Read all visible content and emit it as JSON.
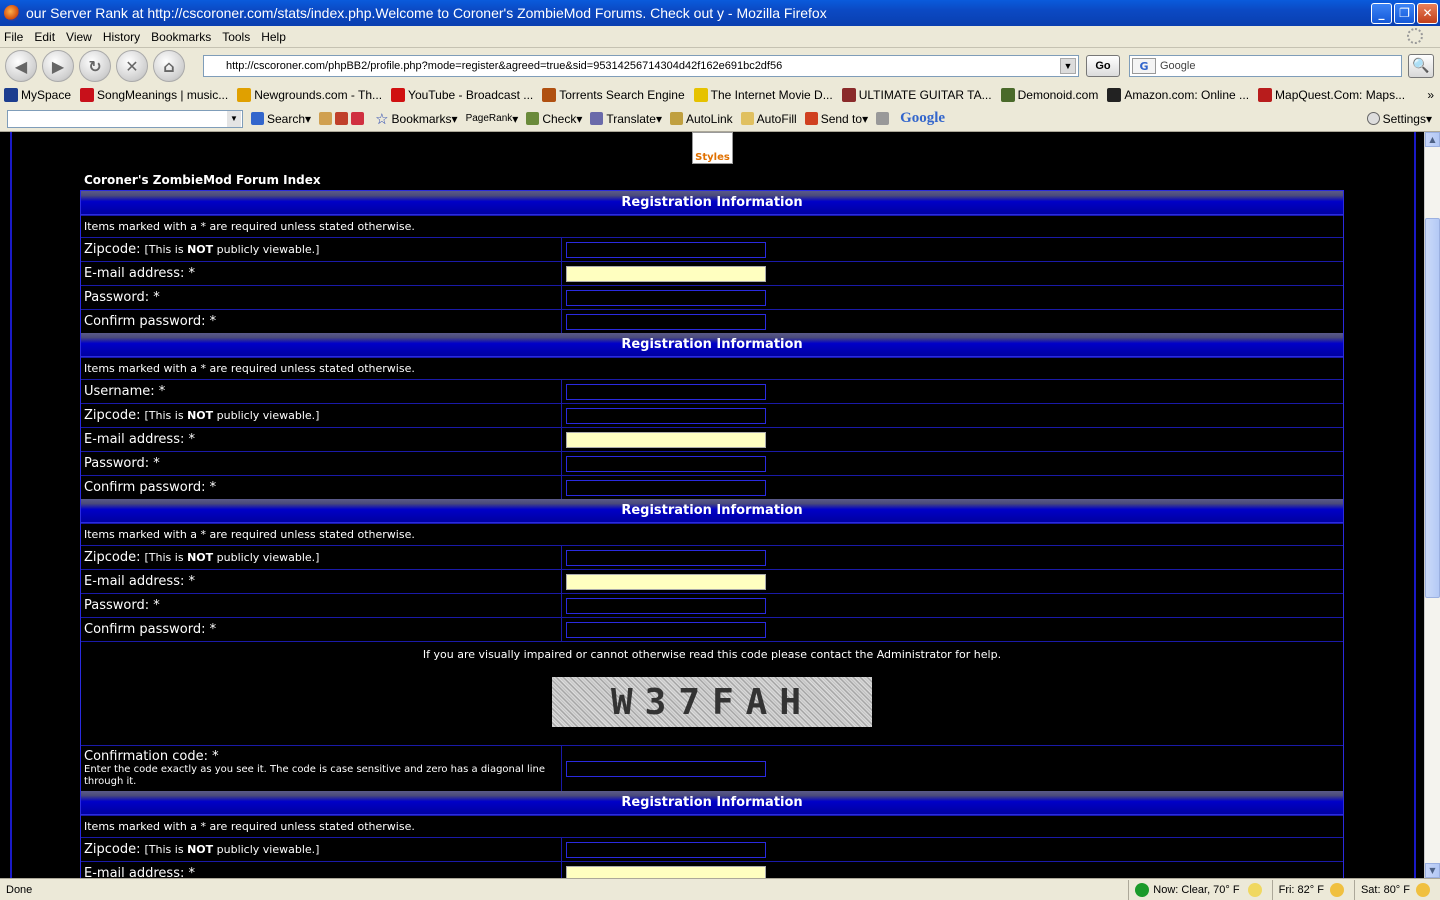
{
  "window": {
    "title": "our Server Rank at http://cscoroner.com/stats/index.php.Welcome to Coroner's ZombieMod Forums. Check out y - Mozilla Firefox"
  },
  "menu": [
    "File",
    "Edit",
    "View",
    "History",
    "Bookmarks",
    "Tools",
    "Help"
  ],
  "nav": {
    "url": "http://cscoroner.com/phpBB2/profile.php?mode=register&agreed=true&sid=95314256714304d42f162e691bc2df56",
    "go_label": "Go",
    "search_placeholder": "Google"
  },
  "bookmarks": [
    {
      "label": "MySpace",
      "color": "#1c3d8f"
    },
    {
      "label": "SongMeanings | music...",
      "color": "#c8101a"
    },
    {
      "label": "Newgrounds.com - Th...",
      "color": "#e0a000"
    },
    {
      "label": "YouTube - Broadcast ...",
      "color": "#d01010"
    },
    {
      "label": "Torrents Search Engine",
      "color": "#b05010"
    },
    {
      "label": "The Internet Movie D...",
      "color": "#e6c200"
    },
    {
      "label": "ULTIMATE GUITAR TA...",
      "color": "#8a2a2a"
    },
    {
      "label": "Demonoid.com",
      "color": "#4a6a2a"
    },
    {
      "label": "Amazon.com: Online ...",
      "color": "#222222"
    },
    {
      "label": "MapQuest.Com: Maps...",
      "color": "#b81c1c"
    }
  ],
  "googlebar": {
    "search_label": "Search",
    "bookmarks_label": "Bookmarks",
    "pagerank_label": "PageRank",
    "check_label": "Check",
    "translate_label": "Translate",
    "autolink_label": "AutoLink",
    "autofill_label": "AutoFill",
    "sendto_label": "Send to",
    "google_label": "Google",
    "settings_label": "Settings"
  },
  "page": {
    "styles_label": "Styles",
    "forum_index": "Coroner's ZombieMod Forum Index",
    "header": "Registration Information",
    "note": "Items marked with a * are required unless stated otherwise.",
    "zipcode_label": "Zipcode:",
    "zipcode_note_pre": "[This is ",
    "zipcode_note_bold": "NOT",
    "zipcode_note_post": " publicly viewable.]",
    "email_label": "E-mail address: *",
    "password_label": "Password: *",
    "confirm_label": "Confirm password: *",
    "username_label": "Username: *",
    "captcha_note": "If you are visually impaired or cannot otherwise read this code please contact the Administrator for help.",
    "captcha_text": "W37FAH",
    "confirm_code_label": "Confirmation code: *",
    "confirm_code_desc": "Enter the code exactly as you see it. The code is case sensitive and zero has a diagonal line through it."
  },
  "status": {
    "text": "Done",
    "weather_now": "Now: Clear, 70° F",
    "fri": "Fri: 82° F",
    "sat": "Sat: 80° F"
  },
  "colors": {
    "accent": "#0000c8",
    "border": "#2a2adf",
    "highlight_input": "#ffffc0"
  }
}
